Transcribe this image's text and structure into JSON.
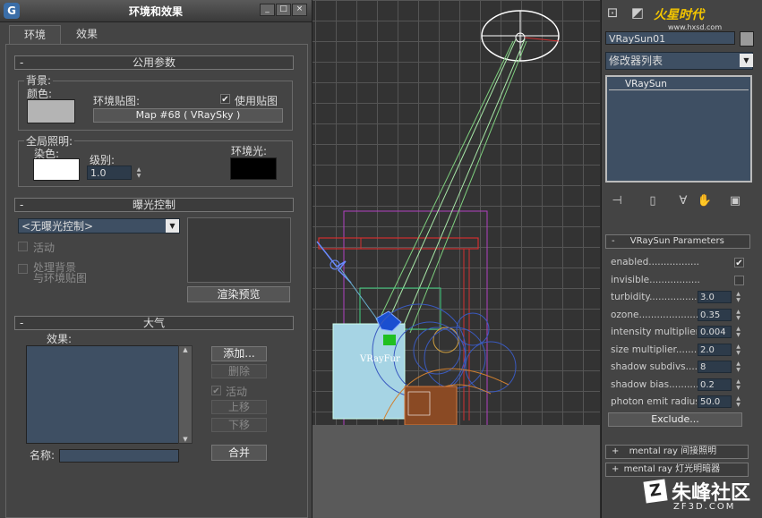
{
  "dialog": {
    "title": "环境和效果",
    "window_buttons": [
      "_",
      "□",
      "×"
    ],
    "tabs": [
      {
        "label": "环境"
      },
      {
        "label": "效果"
      }
    ],
    "common": {
      "header": "公用参数",
      "collapse": "-",
      "background_label": "背景:",
      "color_label": "颜色:",
      "env_map_label": "环境贴图:",
      "use_map_label": "使用贴图",
      "map_button": "Map #68    ( VRaySky )",
      "gi_label": "全局照明:",
      "tint_label": "染色:",
      "level_label": "级别:",
      "level_value": "1.0",
      "ambient_label": "环境光:",
      "background_color": "#b4b4b4",
      "tint_color": "#ffffff",
      "ambient_color": "#000000"
    },
    "exposure": {
      "header": "曝光控制",
      "collapse": "-",
      "select_value": "<无曝光控制>",
      "active_label": "活动",
      "process_label_1": "处理背景",
      "process_label_2": "与环境贴图",
      "render_preview": "渲染预览"
    },
    "atmosphere": {
      "header": "大气",
      "collapse": "-",
      "effects_label": "效果:",
      "add": "添加...",
      "delete": "删除",
      "active": "活动",
      "move_up": "上移",
      "move_down": "下移",
      "name_label": "名称:",
      "merge": "合并"
    }
  },
  "viewport": {
    "object_label": "VRayFur"
  },
  "command_panel": {
    "watermark": "火星时代",
    "watermark_url": "www.hxsd.com",
    "object_name": "VRaySun01",
    "modifier_list": "修改器列表",
    "stack_item": "VRaySun",
    "params_header": "VRaySun Parameters",
    "params": [
      {
        "label": "enabled",
        "value": ""
      },
      {
        "label": "invisible",
        "value": ""
      },
      {
        "label": "turbidity",
        "value": "3.0"
      },
      {
        "label": "ozone",
        "value": "0.35"
      },
      {
        "label": "intensity multiplier",
        "value": "0.004"
      },
      {
        "label": "size multiplier",
        "value": "2.0"
      },
      {
        "label": "shadow subdivs",
        "value": "8"
      },
      {
        "label": "shadow bias",
        "value": "0.2"
      },
      {
        "label": "photon emit radius",
        "value": "50.0"
      }
    ],
    "exclude": "Exclude...",
    "rollouts": [
      "mental ray 间接照明",
      "mental ray 灯光明暗器"
    ]
  },
  "branding": {
    "site_name": "朱峰社区",
    "site_url": "ZF3D.COM"
  }
}
